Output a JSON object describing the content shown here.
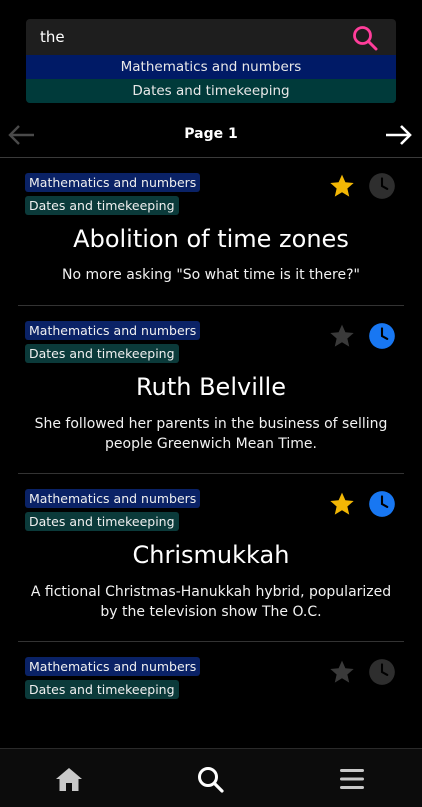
{
  "search": {
    "value": "the",
    "placeholder": ""
  },
  "filters": [
    "Mathematics and numbers",
    "Dates and timekeeping"
  ],
  "pager": {
    "label": "Page 1"
  },
  "colors": {
    "star_active": "#f2b705",
    "star_inactive": "#3a3a3a",
    "clock_active": "#1877f2",
    "clock_inactive": "#2e2e2e",
    "search_icon": "#ff3d9a"
  },
  "cards": [
    {
      "tags": [
        "Mathematics and numbers",
        "Dates and timekeeping"
      ],
      "title": "Abolition of time zones",
      "description": "No more asking \"So what time is it there?\"",
      "starred": true,
      "scheduled": false
    },
    {
      "tags": [
        "Mathematics and numbers",
        "Dates and timekeeping"
      ],
      "title": "Ruth Belville",
      "description": "She followed her parents in the business of selling people Greenwich Mean Time.",
      "starred": false,
      "scheduled": true
    },
    {
      "tags": [
        "Mathematics and numbers",
        "Dates and timekeeping"
      ],
      "title": "Chrismukkah",
      "description": "A fictional Christmas-Hanukkah hybrid, popularized by the television show The O.C.",
      "starred": true,
      "scheduled": true
    },
    {
      "tags": [
        "Mathematics and numbers",
        "Dates and timekeeping"
      ],
      "title": "",
      "description": "",
      "starred": false,
      "scheduled": false
    }
  ],
  "bottom_nav": {
    "items": [
      "home-icon",
      "search-icon",
      "menu-icon"
    ]
  }
}
